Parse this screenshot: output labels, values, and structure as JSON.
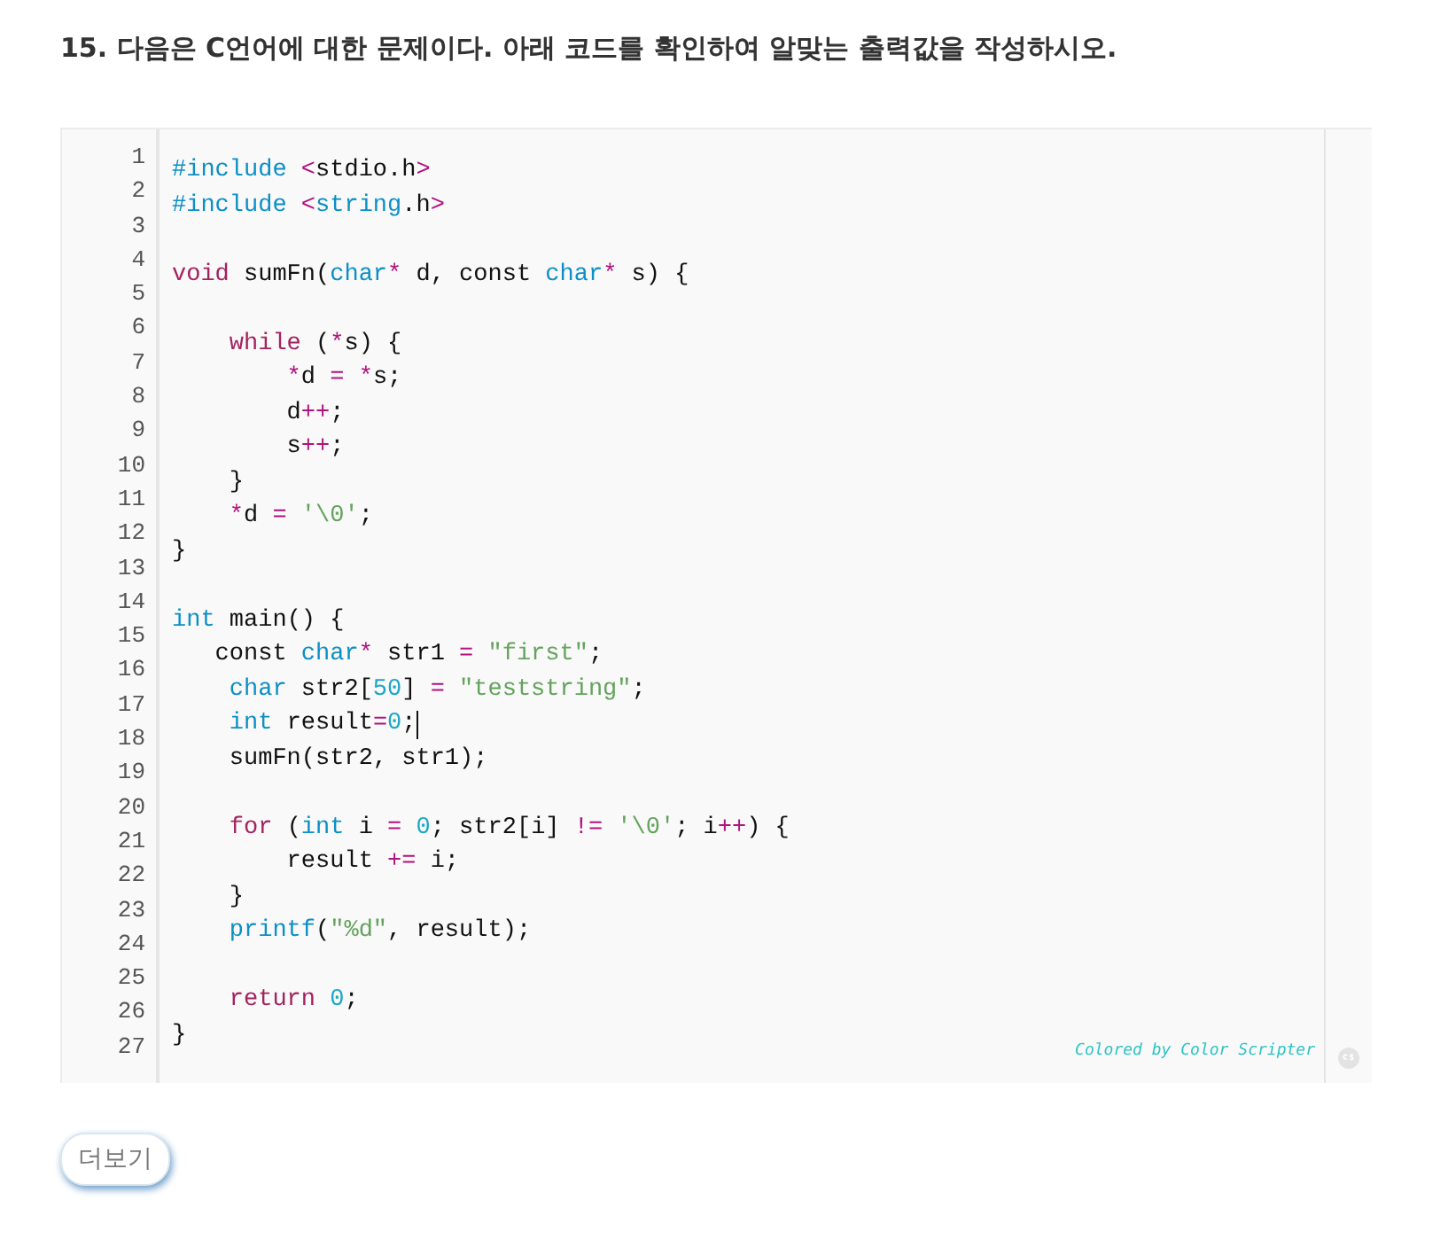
{
  "question": {
    "title": "15. 다음은 C언어에 대한 문제이다. 아래 코드를 확인하여 알맞는 출력값을 작성하시오."
  },
  "code": {
    "line_numbers": [
      "1",
      "2",
      "3",
      "4",
      "5",
      "6",
      "7",
      "8",
      "9",
      "10",
      "11",
      "12",
      "13",
      "14",
      "15",
      "16",
      "17",
      "18",
      "19",
      "20",
      "21",
      "22",
      "23",
      "24",
      "25",
      "26",
      "27"
    ],
    "lines": [
      {
        "kind": "code",
        "tokens": [
          {
            "t": "#include",
            "kind": "type"
          },
          {
            "t": " <",
            "kind": "op"
          },
          {
            "t": "stdio.h",
            "kind": "plain"
          },
          {
            "t": ">",
            "kind": "op"
          }
        ]
      },
      {
        "kind": "code",
        "tokens": [
          {
            "t": "#include",
            "kind": "type"
          },
          {
            "t": " <",
            "kind": "op"
          },
          {
            "t": "string",
            "kind": "type"
          },
          {
            "t": ".h",
            "kind": "plain"
          },
          {
            "t": ">",
            "kind": "op"
          }
        ]
      },
      {
        "kind": "blank"
      },
      {
        "kind": "code",
        "tokens": [
          {
            "t": "void",
            "kind": "keyword"
          },
          {
            "t": " sumFn(",
            "kind": "plain"
          },
          {
            "t": "char",
            "kind": "type"
          },
          {
            "t": "*",
            "kind": "op"
          },
          {
            "t": " d, const ",
            "kind": "plain"
          },
          {
            "t": "char",
            "kind": "type"
          },
          {
            "t": "*",
            "kind": "op"
          },
          {
            "t": " s) {",
            "kind": "plain"
          }
        ]
      },
      {
        "kind": "blank"
      },
      {
        "kind": "code",
        "tokens": [
          {
            "t": "    while",
            "kind": "keyword"
          },
          {
            "t": " (",
            "kind": "plain"
          },
          {
            "t": "*",
            "kind": "op"
          },
          {
            "t": "s) {",
            "kind": "plain"
          }
        ]
      },
      {
        "kind": "code",
        "tokens": [
          {
            "t": "        *",
            "kind": "op"
          },
          {
            "t": "d ",
            "kind": "plain"
          },
          {
            "t": "= *",
            "kind": "op"
          },
          {
            "t": "s;",
            "kind": "plain"
          }
        ]
      },
      {
        "kind": "code",
        "tokens": [
          {
            "t": "        d",
            "kind": "plain"
          },
          {
            "t": "++",
            "kind": "op"
          },
          {
            "t": ";",
            "kind": "plain"
          }
        ]
      },
      {
        "kind": "code",
        "tokens": [
          {
            "t": "        s",
            "kind": "plain"
          },
          {
            "t": "++",
            "kind": "op"
          },
          {
            "t": ";",
            "kind": "plain"
          }
        ]
      },
      {
        "kind": "code",
        "tokens": [
          {
            "t": "    }",
            "kind": "plain"
          }
        ]
      },
      {
        "kind": "code",
        "tokens": [
          {
            "t": "    *",
            "kind": "op"
          },
          {
            "t": "d ",
            "kind": "plain"
          },
          {
            "t": "=",
            "kind": "op"
          },
          {
            "t": " '\\0'",
            "kind": "string"
          },
          {
            "t": ";",
            "kind": "plain"
          }
        ]
      },
      {
        "kind": "code",
        "tokens": [
          {
            "t": "}",
            "kind": "plain"
          }
        ]
      },
      {
        "kind": "blank"
      },
      {
        "kind": "code",
        "tokens": [
          {
            "t": "int",
            "kind": "type"
          },
          {
            "t": " main() {",
            "kind": "plain"
          }
        ]
      },
      {
        "kind": "code",
        "tokens": [
          {
            "t": "   const ",
            "kind": "plain"
          },
          {
            "t": "char",
            "kind": "type"
          },
          {
            "t": "*",
            "kind": "op"
          },
          {
            "t": " str1 ",
            "kind": "plain"
          },
          {
            "t": "=",
            "kind": "op"
          },
          {
            "t": " \"first\"",
            "kind": "string"
          },
          {
            "t": ";",
            "kind": "plain"
          }
        ]
      },
      {
        "kind": "code",
        "tokens": [
          {
            "t": "    char",
            "kind": "type"
          },
          {
            "t": " str2[",
            "kind": "plain"
          },
          {
            "t": "50",
            "kind": "number"
          },
          {
            "t": "] ",
            "kind": "plain"
          },
          {
            "t": "=",
            "kind": "op"
          },
          {
            "t": " \"teststring\"",
            "kind": "string"
          },
          {
            "t": ";",
            "kind": "plain"
          }
        ]
      },
      {
        "kind": "code",
        "cursor": true,
        "tokens": [
          {
            "t": "    int",
            "kind": "type"
          },
          {
            "t": " result",
            "kind": "plain"
          },
          {
            "t": "=",
            "kind": "op"
          },
          {
            "t": "0",
            "kind": "number"
          },
          {
            "t": ";",
            "kind": "plain"
          }
        ]
      },
      {
        "kind": "code",
        "tokens": [
          {
            "t": "    sumFn(str2, str1);",
            "kind": "plain"
          }
        ]
      },
      {
        "kind": "blank"
      },
      {
        "kind": "code",
        "tokens": [
          {
            "t": "    for",
            "kind": "keyword"
          },
          {
            "t": " (",
            "kind": "plain"
          },
          {
            "t": "int",
            "kind": "type"
          },
          {
            "t": " i ",
            "kind": "plain"
          },
          {
            "t": "=",
            "kind": "op"
          },
          {
            "t": " 0",
            "kind": "number"
          },
          {
            "t": "; str2[i] ",
            "kind": "plain"
          },
          {
            "t": "!=",
            "kind": "op"
          },
          {
            "t": " '\\0'",
            "kind": "string"
          },
          {
            "t": "; i",
            "kind": "plain"
          },
          {
            "t": "++",
            "kind": "op"
          },
          {
            "t": ") {",
            "kind": "plain"
          }
        ]
      },
      {
        "kind": "code",
        "tokens": [
          {
            "t": "        result ",
            "kind": "plain"
          },
          {
            "t": "+=",
            "kind": "op"
          },
          {
            "t": " i;",
            "kind": "plain"
          }
        ]
      },
      {
        "kind": "code",
        "tokens": [
          {
            "t": "    }",
            "kind": "plain"
          }
        ]
      },
      {
        "kind": "code",
        "tokens": [
          {
            "t": "    printf",
            "kind": "type"
          },
          {
            "t": "(",
            "kind": "plain"
          },
          {
            "t": "\"%d\"",
            "kind": "string"
          },
          {
            "t": ", result);",
            "kind": "plain"
          }
        ]
      },
      {
        "kind": "blank"
      },
      {
        "kind": "code",
        "tokens": [
          {
            "t": "    return",
            "kind": "keyword"
          },
          {
            "t": " 0",
            "kind": "number"
          },
          {
            "t": ";",
            "kind": "plain"
          }
        ]
      },
      {
        "kind": "code",
        "tokens": [
          {
            "t": "}",
            "kind": "plain"
          }
        ]
      }
    ],
    "credit": "Colored by Color Scripter"
  },
  "more_button": {
    "label": "더보기"
  }
}
